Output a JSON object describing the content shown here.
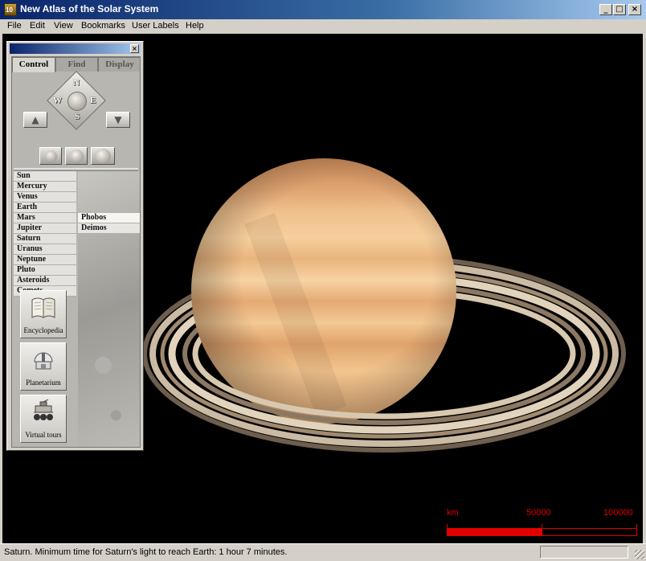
{
  "window": {
    "title": "New Atlas of the Solar System",
    "minimize": "_",
    "maximize": "□",
    "close": "×"
  },
  "menu": [
    "File",
    "Edit",
    "View",
    "Bookmarks",
    "User Labels",
    "Help"
  ],
  "panel": {
    "close": "×",
    "tabs": [
      "Control",
      "Find",
      "Display"
    ],
    "active_tab": "Control",
    "compass": {
      "north": "N",
      "south": "S",
      "east": "E",
      "west": "W"
    },
    "up_glyph": "▲",
    "down_glyph": "▼",
    "planets": [
      "Sun",
      "Mercury",
      "Venus",
      "Earth",
      "Mars",
      "Jupiter",
      "Saturn",
      "Uranus",
      "Neptune",
      "Pluto",
      "Asteroids",
      "Comets"
    ],
    "moons": [
      "Phobos",
      "Deimos"
    ],
    "tools": [
      {
        "label": "Encyclopedia",
        "icon": "book-icon"
      },
      {
        "label": "Planetarium",
        "icon": "observatory-icon"
      },
      {
        "label": "Virtual tours",
        "icon": "rover-icon"
      }
    ]
  },
  "scale": {
    "unit": "km",
    "mid": "50000",
    "max": "100000",
    "fill_fraction": 0.5,
    "color": "#e00000"
  },
  "status": {
    "text": "Saturn. Minimum time for Saturn's light to reach Earth: 1 hour 7 minutes."
  },
  "colors": {
    "title_bar": "#0a246a",
    "viewport": "#000000",
    "chrome": "#d4d0c8"
  }
}
